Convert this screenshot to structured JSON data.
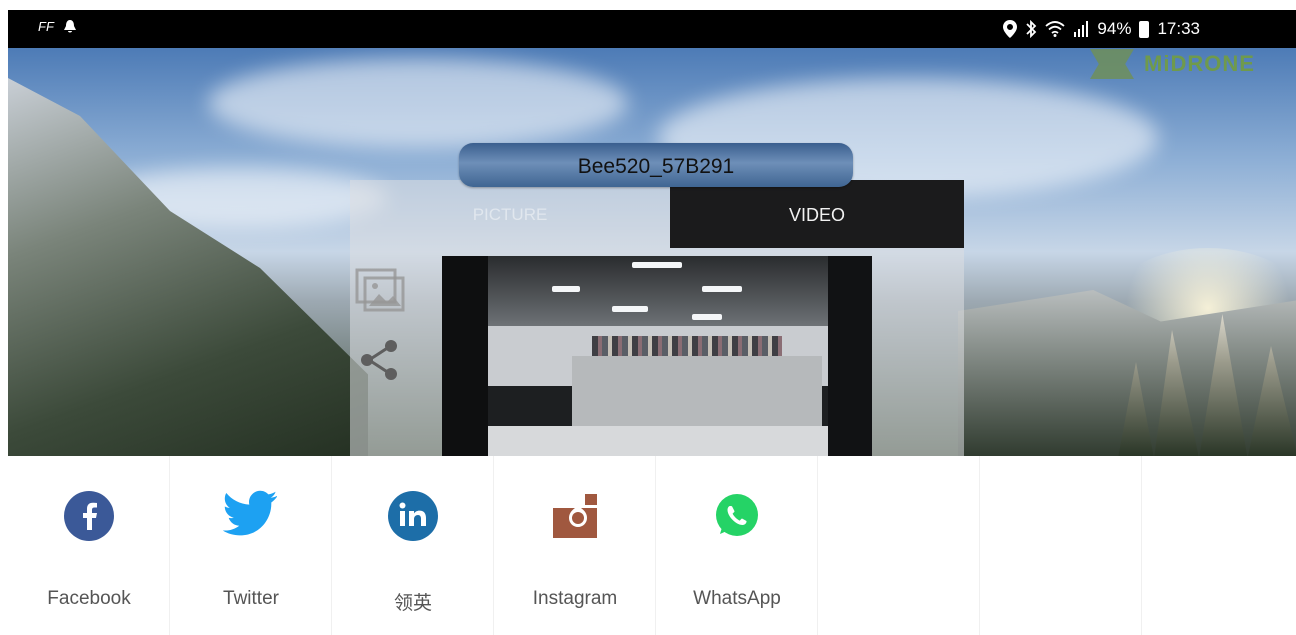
{
  "status_bar": {
    "left_text": "FF",
    "battery_percent": "94%",
    "time": "17:33",
    "icons": [
      "notification-icon",
      "location-icon",
      "bluetooth-icon",
      "wifi-icon",
      "signal-icon",
      "battery-icon"
    ]
  },
  "brand": {
    "logo_text": "MiDRONE",
    "accent_color": "#6f9a4c"
  },
  "device": {
    "name": "Bee520_57B291"
  },
  "tabs": [
    {
      "label": "PICTURE",
      "active": false
    },
    {
      "label": "VIDEO",
      "active": true
    }
  ],
  "side_actions": [
    {
      "icon": "gallery-icon"
    },
    {
      "icon": "share-icon"
    }
  ],
  "share_targets": [
    {
      "label": "Facebook",
      "icon": "facebook-icon",
      "color": "#3b5998"
    },
    {
      "label": "Twitter",
      "icon": "twitter-icon",
      "color": "#1da1f2"
    },
    {
      "label": "领英",
      "icon": "linkedin-icon",
      "color": "#1d6ea8"
    },
    {
      "label": "Instagram",
      "icon": "instagram-icon",
      "color": "#a0583f"
    },
    {
      "label": "WhatsApp",
      "icon": "whatsapp-icon",
      "color": "#25d366"
    }
  ]
}
